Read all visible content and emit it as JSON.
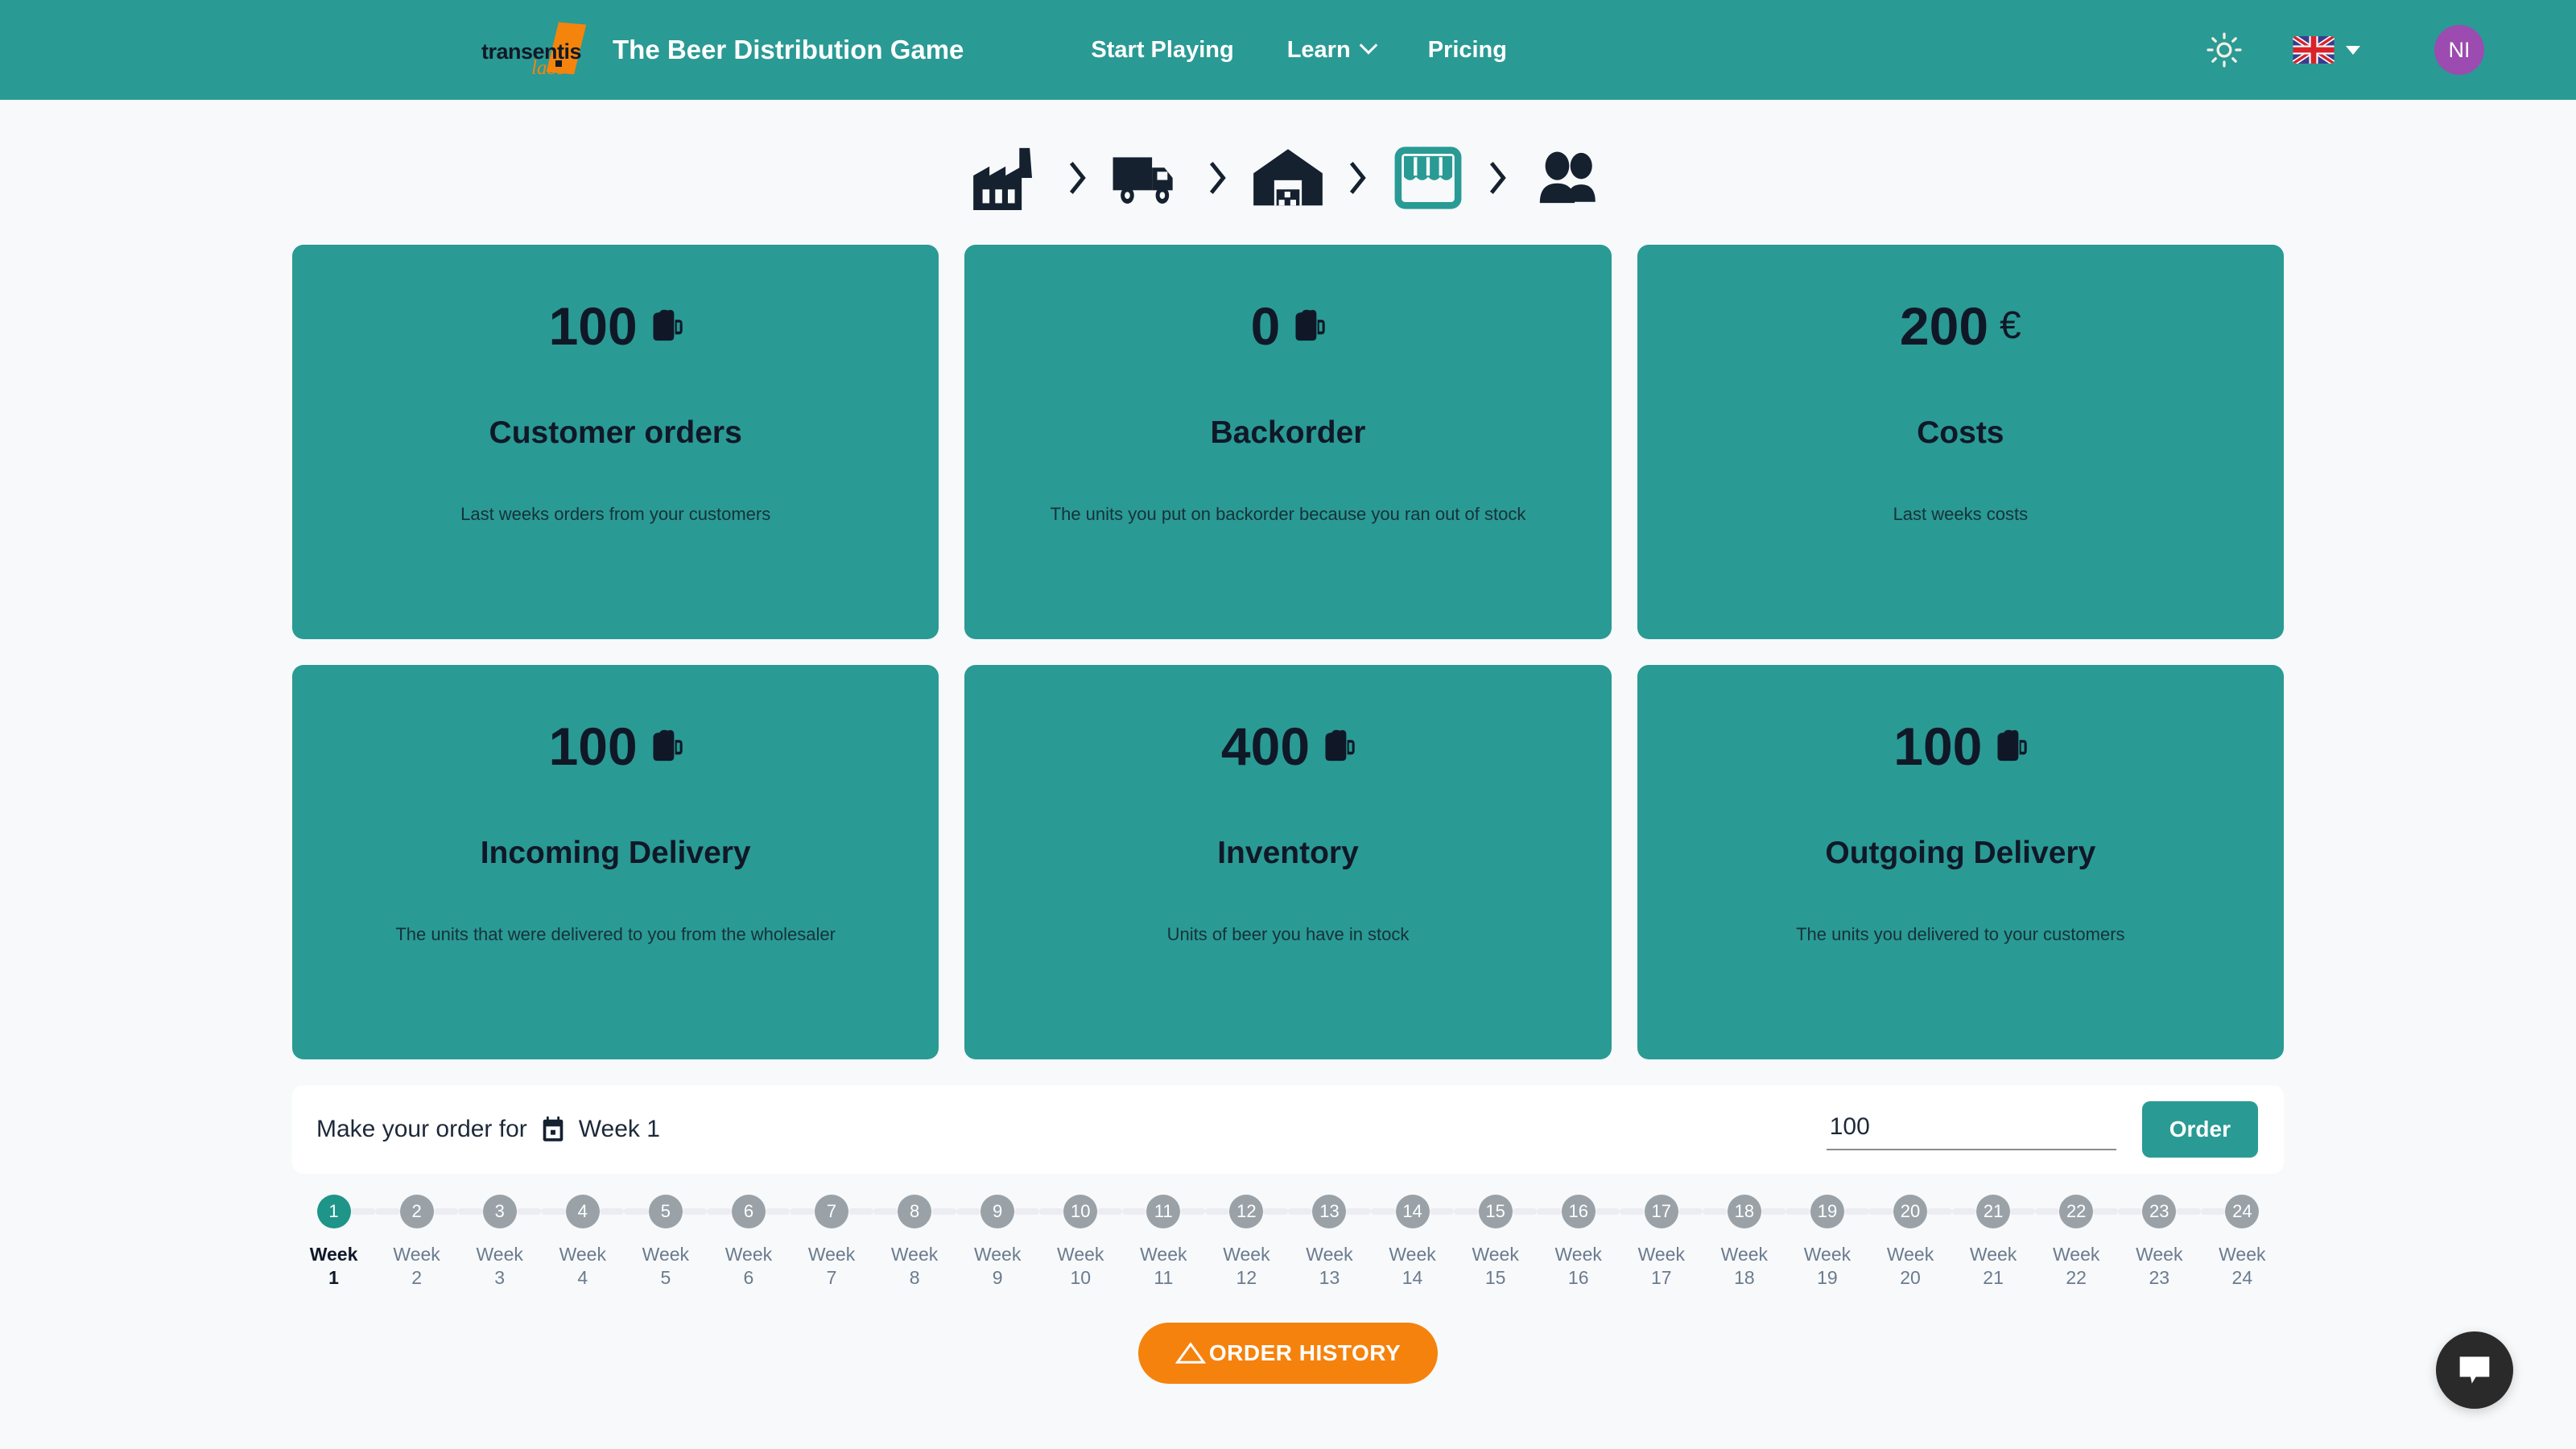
{
  "header": {
    "logo_word": "transentis",
    "logo_sub": "labs",
    "site_title": "The Beer Distribution Game",
    "nav": [
      {
        "label": "Start Playing",
        "has_dropdown": false
      },
      {
        "label": "Learn",
        "has_dropdown": true
      },
      {
        "label": "Pricing",
        "has_dropdown": false
      }
    ],
    "theme_toggle_icon": "sun-icon",
    "language": {
      "flag": "uk-flag-icon",
      "dropdown_icon": "chevron-down-icon"
    },
    "avatar_initials": "NI"
  },
  "supply_chain": {
    "nodes": [
      {
        "icon": "factory-icon",
        "active": false
      },
      {
        "icon": "truck-icon",
        "active": false
      },
      {
        "icon": "warehouse-icon",
        "active": false
      },
      {
        "icon": "store-icon",
        "active": true
      },
      {
        "icon": "customers-icon",
        "active": false
      }
    ],
    "separator_icon": "chevron-right-icon"
  },
  "stats": [
    {
      "value": "100",
      "unit_icon": "beer-mug-icon",
      "unit_symbol": "",
      "title": "Customer orders",
      "description": "Last weeks orders from your customers"
    },
    {
      "value": "0",
      "unit_icon": "beer-mug-icon",
      "unit_symbol": "",
      "title": "Backorder",
      "description": "The units you put on backorder because you ran out of stock"
    },
    {
      "value": "200",
      "unit_icon": "",
      "unit_symbol": "€",
      "title": "Costs",
      "description": "Last weeks costs"
    },
    {
      "value": "100",
      "unit_icon": "beer-mug-icon",
      "unit_symbol": "",
      "title": "Incoming Delivery",
      "description": "The units that were delivered to you from the wholesaler"
    },
    {
      "value": "400",
      "unit_icon": "beer-mug-icon",
      "unit_symbol": "",
      "title": "Inventory",
      "description": "Units of beer you have in stock"
    },
    {
      "value": "100",
      "unit_icon": "beer-mug-icon",
      "unit_symbol": "",
      "title": "Outgoing Delivery",
      "description": "The units you delivered to your customers"
    }
  ],
  "order_bar": {
    "label": "Make your order for",
    "calendar_icon": "calendar-icon",
    "week_label": "Week 1",
    "input_value": "100",
    "input_placeholder": "",
    "button_label": "Order"
  },
  "stepper": {
    "active_week": 1,
    "steps": [
      {
        "number": "1",
        "label": "Week\n1"
      },
      {
        "number": "2",
        "label": "Week\n2"
      },
      {
        "number": "3",
        "label": "Week\n3"
      },
      {
        "number": "4",
        "label": "Week\n4"
      },
      {
        "number": "5",
        "label": "Week\n5"
      },
      {
        "number": "6",
        "label": "Week\n6"
      },
      {
        "number": "7",
        "label": "Week\n7"
      },
      {
        "number": "8",
        "label": "Week\n8"
      },
      {
        "number": "9",
        "label": "Week\n9"
      },
      {
        "number": "10",
        "label": "Week\n10"
      },
      {
        "number": "11",
        "label": "Week\n11"
      },
      {
        "number": "12",
        "label": "Week\n12"
      },
      {
        "number": "13",
        "label": "Week\n13"
      },
      {
        "number": "14",
        "label": "Week\n14"
      },
      {
        "number": "15",
        "label": "Week\n15"
      },
      {
        "number": "16",
        "label": "Week\n16"
      },
      {
        "number": "17",
        "label": "Week\n17"
      },
      {
        "number": "18",
        "label": "Week\n18"
      },
      {
        "number": "19",
        "label": "Week\n19"
      },
      {
        "number": "20",
        "label": "Week\n20"
      },
      {
        "number": "21",
        "label": "Week\n21"
      },
      {
        "number": "22",
        "label": "Week\n22"
      },
      {
        "number": "23",
        "label": "Week\n23"
      },
      {
        "number": "24",
        "label": "Week\n24"
      }
    ]
  },
  "history": {
    "icon": "chart-triangle-icon",
    "label": "ORDER HISTORY"
  },
  "chat": {
    "icon": "chat-bubble-icon"
  },
  "colors": {
    "brand_teal": "#2a9a94",
    "accent_orange": "#f5820d",
    "page_bg": "#f7f9fb",
    "card_text": "#101828",
    "avatar_purple": "#9c4bb0",
    "step_inactive": "#9aa2a8",
    "step_active": "#1f9489",
    "chat_bg": "#2a2a2a"
  }
}
